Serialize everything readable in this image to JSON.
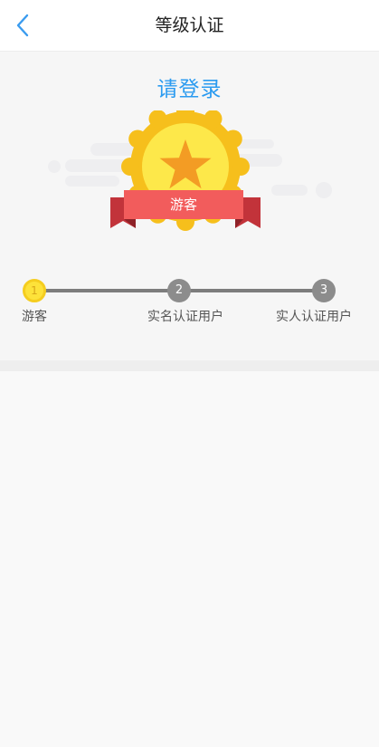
{
  "header": {
    "title": "等级认证",
    "back_icon": "chevron-left-icon",
    "back_color": "#3a9bef"
  },
  "hero": {
    "login_text": "请登录",
    "badge_label": "游客",
    "badge_icon": "star-medal-icon"
  },
  "steps": [
    {
      "number": "1",
      "label": "游客",
      "active": true
    },
    {
      "number": "2",
      "label": "实名认证用户",
      "active": false
    },
    {
      "number": "3",
      "label": "实人认证用户",
      "active": false
    }
  ],
  "colors": {
    "accent": "#2b9bf0",
    "active_step": "#fde23a",
    "inactive_step": "#8c8c8c",
    "ribbon": "#f25c5c"
  }
}
